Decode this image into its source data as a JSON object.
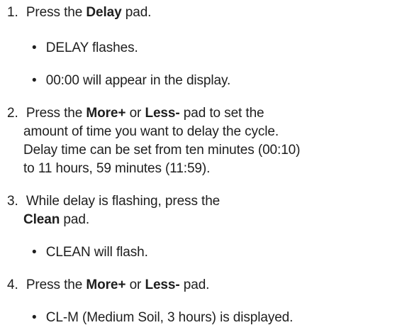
{
  "heading_fragment": "Delay",
  "steps": [
    {
      "num": "1.",
      "pre": "Press the ",
      "b1": "Delay",
      "post": " pad."
    },
    {
      "bullets": [
        "DELAY flashes.",
        "00:00 will appear in the display."
      ]
    },
    {
      "num": "2.",
      "pre": "Press the ",
      "b1": "More+",
      "mid": " or ",
      "b2": "Less-",
      "post": " pad to set the",
      "cont": [
        "amount of time you want to delay the cycle.",
        "Delay time can be set from ten minutes (00:10)",
        "to 11 hours, 59 minutes (11:59)."
      ]
    },
    {
      "num": "3.",
      "text1": "While delay is flashing, press the",
      "b1": "Clean",
      "post": " pad."
    },
    {
      "bullets": [
        "CLEAN will flash."
      ]
    },
    {
      "num": "4.",
      "pre": "Press the ",
      "b1": "More+",
      "mid": " or ",
      "b2": "Less-",
      "post": " pad."
    },
    {
      "bullets": [
        "CL-M (Medium Soil, 3 hours) is displayed."
      ]
    }
  ],
  "bullet_glyph": "•"
}
